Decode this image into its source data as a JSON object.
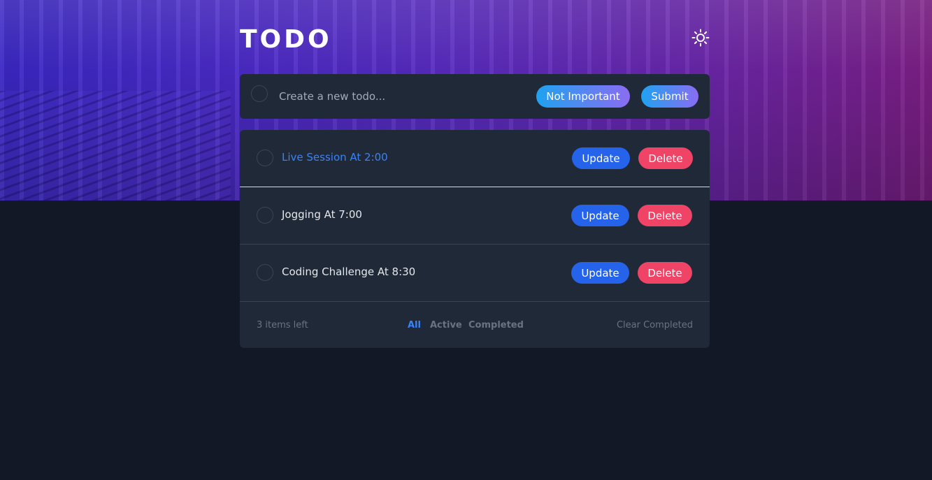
{
  "app": {
    "title": "TODO"
  },
  "theme_toggle": {
    "icon": "sun-icon"
  },
  "new_todo": {
    "placeholder": "Create a new todo...",
    "value": "",
    "importance_label": "Not Important",
    "submit_label": "Submit"
  },
  "todos": [
    {
      "label": "Live Session At 2:00",
      "important": true,
      "update_label": "Update",
      "delete_label": "Delete"
    },
    {
      "label": "Jogging At 7:00",
      "important": false,
      "update_label": "Update",
      "delete_label": "Delete"
    },
    {
      "label": "Coding Challenge At 8:30",
      "important": false,
      "update_label": "Update",
      "delete_label": "Delete"
    }
  ],
  "footer": {
    "items_left": "3 items left",
    "filters": [
      "All",
      "Active",
      "Completed"
    ],
    "active_filter": "All",
    "clear_label": "Clear Completed"
  },
  "colors": {
    "background": "#121826",
    "card": "#1f2937",
    "accent": "#3b82f6",
    "update": "#2563eb",
    "delete": "#ef4466"
  }
}
